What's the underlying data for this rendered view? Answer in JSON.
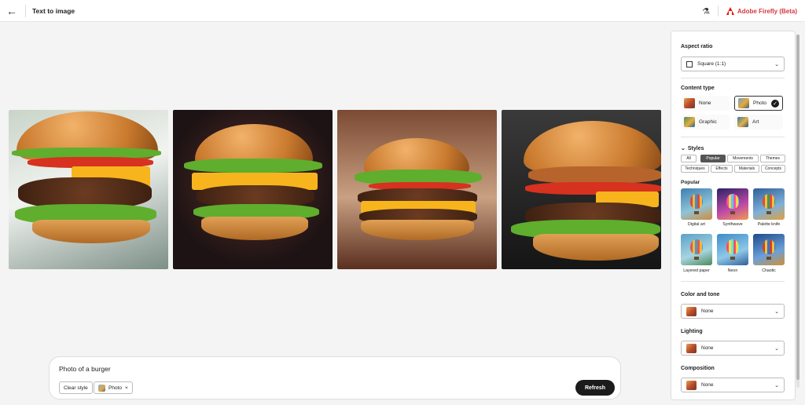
{
  "header": {
    "title": "Text to image",
    "brand": "Adobe Firefly (Beta)"
  },
  "prompt": {
    "text": "Photo of a burger",
    "chips": [
      "Clear style",
      "Photo"
    ],
    "refresh_label": "Refresh"
  },
  "panel": {
    "aspect_ratio": {
      "label": "Aspect ratio",
      "value": "Square (1:1)"
    },
    "content_type": {
      "label": "Content type",
      "options": [
        "None",
        "Photo",
        "Graphic",
        "Art"
      ],
      "selected": "Photo"
    },
    "styles": {
      "label": "Styles",
      "tabs": [
        "All",
        "Popular",
        "Movements",
        "Themes",
        "Techniques",
        "Effects",
        "Materials",
        "Concepts"
      ],
      "active_tab": "Popular",
      "group_label": "Popular",
      "tiles": [
        "Digital art",
        "Synthwave",
        "Palette knife",
        "Layered paper",
        "Neon",
        "Chaotic"
      ]
    },
    "color_tone": {
      "label": "Color and tone",
      "value": "None"
    },
    "lighting": {
      "label": "Lighting",
      "value": "None"
    },
    "composition": {
      "label": "Composition",
      "value": "None"
    }
  }
}
